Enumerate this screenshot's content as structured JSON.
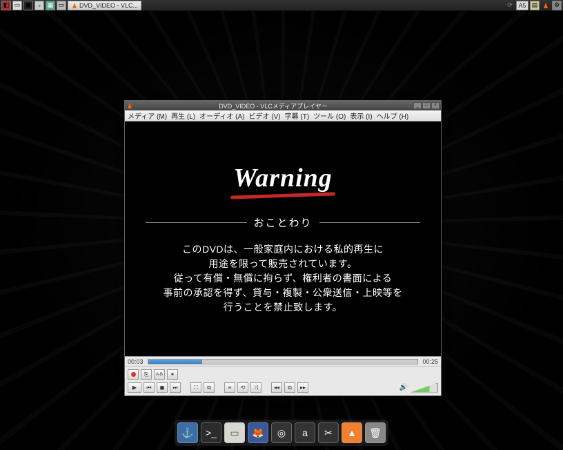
{
  "taskbar": {
    "app_label": "DVD_VIDEO - VLC...",
    "ime_label": "A5"
  },
  "window": {
    "title": "DVD_VIDEO - VLCメディアプレイヤー",
    "menu": [
      "メディア (M)",
      "再生 (L)",
      "オーディオ (A)",
      "ビデオ (V)",
      "字幕 (T)",
      "ツール (O)",
      "表示 (I)",
      "ヘルプ (H)"
    ],
    "video": {
      "warning_title": "Warning",
      "divider_label": "おことわり",
      "line1": "このDVDは、一般家庭内における私的再生に",
      "line2": "用途を限って販売されています。",
      "line3": "従って有償・無償に拘らず、権利者の書面による",
      "line4": "事前の承認を得ず、貸与・複製・公衆送信・上映等を",
      "line5": "行うことを禁止致します。"
    },
    "time": {
      "current": "00:03",
      "total": "00:25",
      "progress_pct": 20
    },
    "volume_pct": 100
  },
  "icons": {
    "play": "▶",
    "prev": "⏮",
    "stop": "◼",
    "next": "⏭",
    "fullscreen": "⛶",
    "playlist": "≡",
    "loop": "⟲",
    "shuffle": "⤨",
    "skip_back": "◂◂",
    "snapshot": "⧉",
    "skip_fwd": "▸▸",
    "record": "●",
    "frame": "⎘",
    "ab": "A-B",
    "effects": "✶",
    "speaker": "🔊"
  },
  "dock": {
    "items": [
      {
        "name": "anchor",
        "glyph": "⚓",
        "bg": "#3a6ea5"
      },
      {
        "name": "terminal",
        "glyph": ">_",
        "bg": "#2b2b2b"
      },
      {
        "name": "files",
        "glyph": "▭",
        "bg": "#d8d8d0"
      },
      {
        "name": "firefox",
        "glyph": "🦊",
        "bg": "#3b5998"
      },
      {
        "name": "camera",
        "glyph": "◎",
        "bg": "#333"
      },
      {
        "name": "audio",
        "glyph": "a",
        "bg": "#333"
      },
      {
        "name": "video-editor",
        "glyph": "✂",
        "bg": "#333"
      },
      {
        "name": "vlc",
        "glyph": "▲",
        "bg": "#f08030"
      },
      {
        "name": "trash",
        "glyph": "🗑",
        "bg": "#888"
      }
    ]
  }
}
